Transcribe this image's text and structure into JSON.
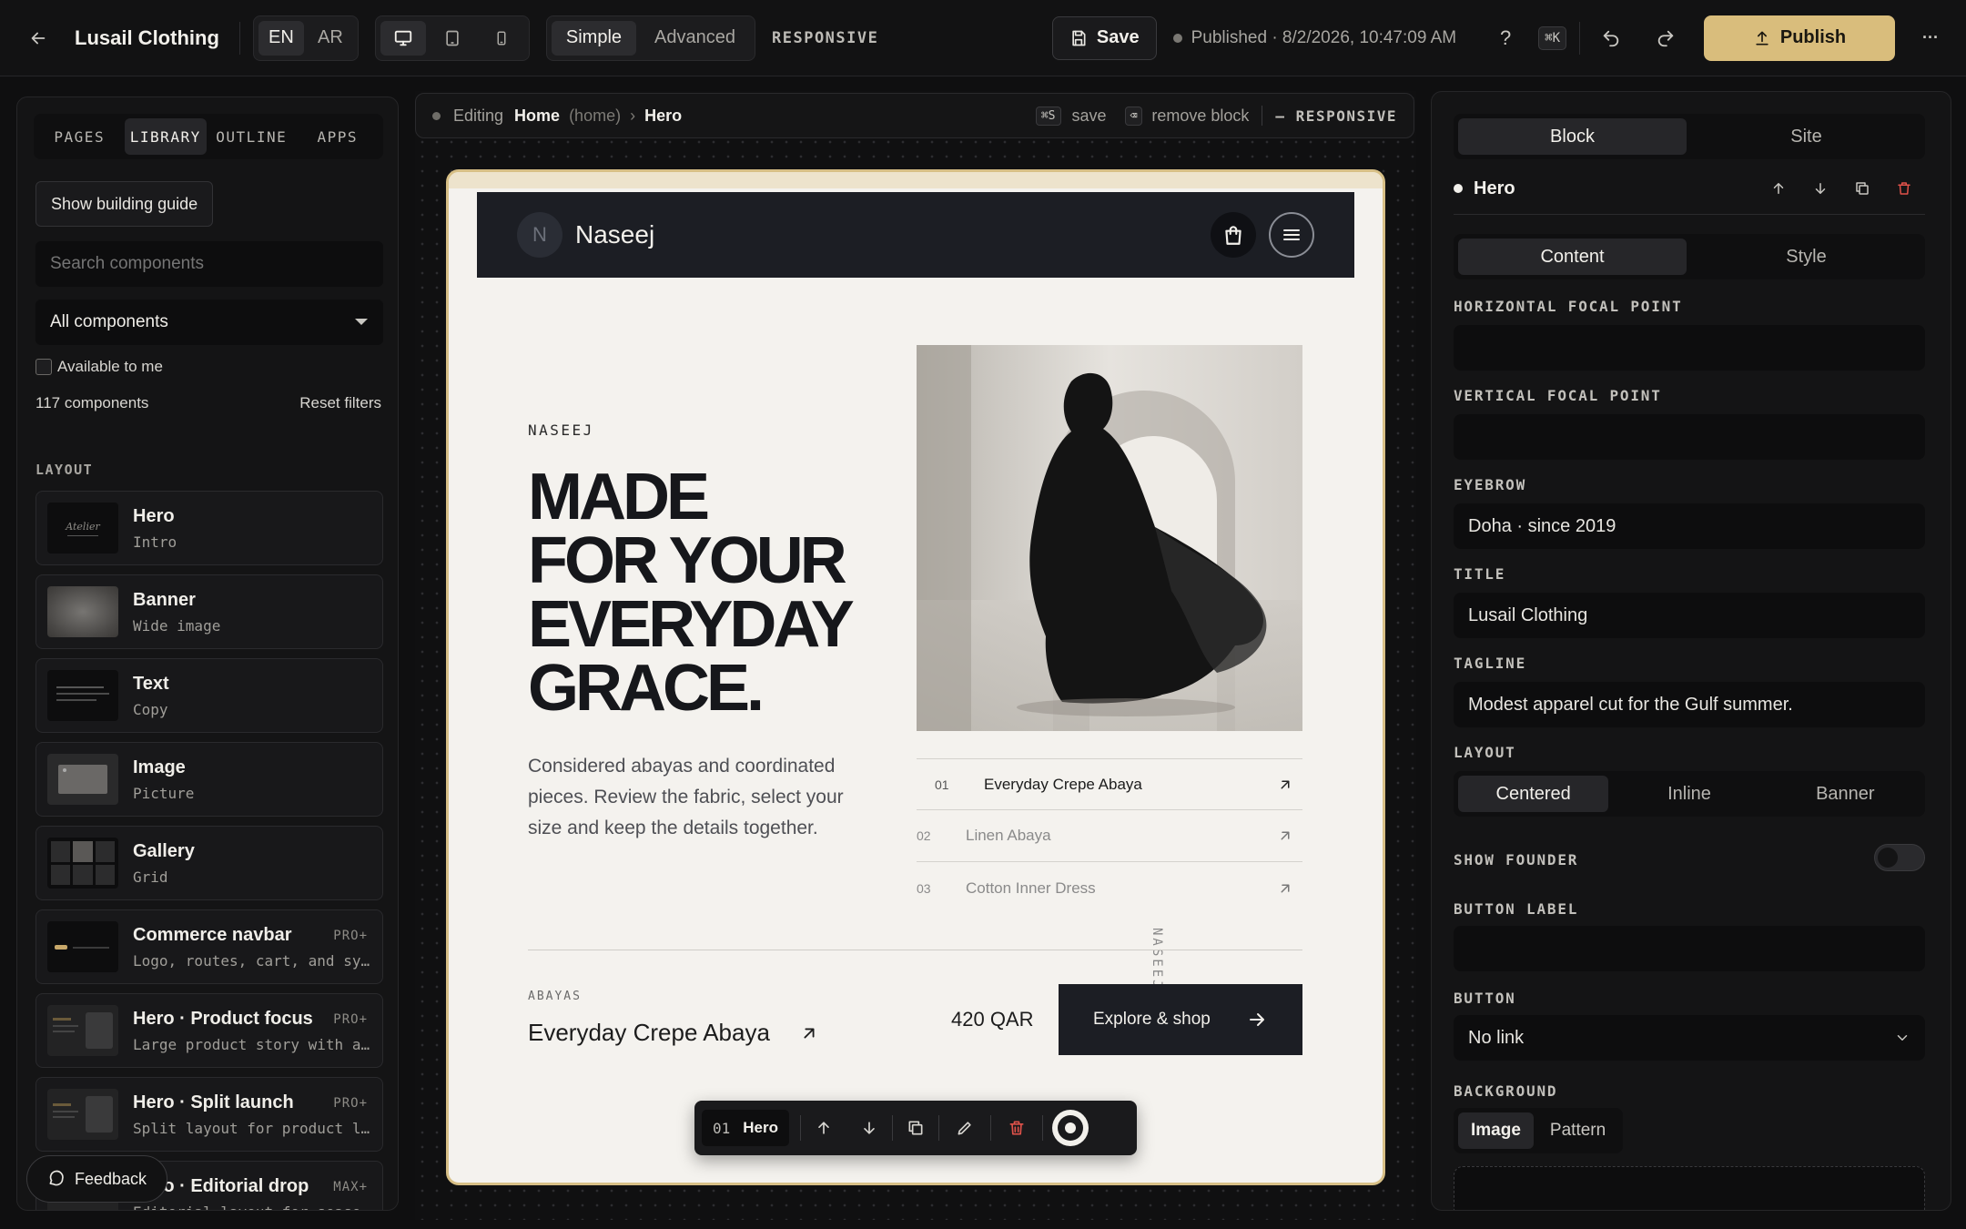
{
  "topbar": {
    "site_name": "Lusail Clothing",
    "languages": [
      "EN",
      "AR"
    ],
    "active_language": "EN",
    "modes": [
      "Simple",
      "Advanced"
    ],
    "active_mode": "Simple",
    "responsive_label": "RESPONSIVE",
    "save_label": "Save",
    "published_status": "Published · 8/2/2026, 10:47:09 AM",
    "help_label": "?",
    "shortcut_label": "⌘K",
    "publish_label": "Publish",
    "more_label": "···"
  },
  "left_panel": {
    "tabs": [
      "PAGES",
      "LIBRARY",
      "OUTLINE",
      "APPS"
    ],
    "active_tab": "LIBRARY",
    "guide_button": "Show building guide",
    "search_placeholder": "Search components",
    "filter_value": "All components",
    "available_label": "Available to me",
    "count_label": "117 components",
    "reset_label": "Reset filters",
    "section_label": "LAYOUT",
    "items": [
      {
        "name": "Hero",
        "desc": "Intro",
        "badge": "",
        "thumb_text": "Atelier"
      },
      {
        "name": "Banner",
        "desc": "Wide image",
        "badge": ""
      },
      {
        "name": "Text",
        "desc": "Copy",
        "badge": ""
      },
      {
        "name": "Image",
        "desc": "Picture",
        "badge": ""
      },
      {
        "name": "Gallery",
        "desc": "Grid",
        "badge": ""
      },
      {
        "name": "Commerce navbar",
        "desc": "Logo, routes, cart, and sy…",
        "badge": "PRO+"
      },
      {
        "name": "Hero · Product focus",
        "desc": "Large product story with a…",
        "badge": "PRO+"
      },
      {
        "name": "Hero · Split launch",
        "desc": "Split layout for product l…",
        "badge": "PRO+"
      },
      {
        "name": "Hero · Editorial drop",
        "desc": "Editorial layout for seasonal…",
        "badge": "MAX+"
      }
    ],
    "feedback_label": "Feedback"
  },
  "breadcrumb": {
    "prefix": "Editing",
    "page": "Home",
    "page_slug": "(home)",
    "separator": "›",
    "block": "Hero",
    "save_key": "⌘S",
    "save_hint": "save",
    "remove_key": "⌫",
    "remove_hint": "remove block",
    "mode": "– RESPONSIVE"
  },
  "preview": {
    "brand_initial": "N",
    "brand_name": "Naseej",
    "eyebrow": "NASEEJ",
    "headline": [
      "MADE",
      "FOR YOUR",
      "EVERYDAY",
      "GRACE."
    ],
    "body": "Considered abayas and coordinated pieces. Review the fabric, select your size and keep the details together.",
    "products": [
      {
        "num": "01",
        "name": "Everyday Crepe Abaya"
      },
      {
        "num": "02",
        "name": "Linen Abaya"
      },
      {
        "num": "03",
        "name": "Cotton Inner Dress"
      }
    ],
    "vertical_label": "NASEEJ",
    "category": "ABAYAS",
    "featured_name": "Everyday Crepe Abaya",
    "price": "420 QAR",
    "cta": "Explore & shop"
  },
  "block_toolbar": {
    "index": "01",
    "name": "Hero"
  },
  "right_panel": {
    "tabs": [
      "Block",
      "Site"
    ],
    "active_tab": "Block",
    "block_name": "Hero",
    "subtabs": [
      "Content",
      "Style"
    ],
    "active_subtab": "Content",
    "fields": {
      "horizontal_focal_label": "HORIZONTAL FOCAL POINT",
      "horizontal_focal_value": "",
      "vertical_focal_label": "VERTICAL FOCAL POINT",
      "vertical_focal_value": "",
      "eyebrow_label": "EYEBROW",
      "eyebrow_value": "Doha · since 2019",
      "title_label": "TITLE",
      "title_value": "Lusail Clothing",
      "tagline_label": "TAGLINE",
      "tagline_value": "Modest apparel cut for the Gulf summer.",
      "layout_label": "LAYOUT",
      "layout_options": [
        "Centered",
        "Inline",
        "Banner"
      ],
      "layout_active": "Centered",
      "founder_label": "SHOW FOUNDER",
      "founder_on": false,
      "button_label_label": "BUTTON LABEL",
      "button_label_value": "",
      "button_label": "BUTTON",
      "button_value": "No link",
      "background_label": "BACKGROUND",
      "background_options": [
        "Image",
        "Pattern"
      ],
      "background_active": "Image"
    }
  },
  "colors": {
    "accent": "#d9bd7c",
    "danger": "#e0524a",
    "frame_border": "#d7bf86",
    "dark_nav": "#1c1e24"
  }
}
